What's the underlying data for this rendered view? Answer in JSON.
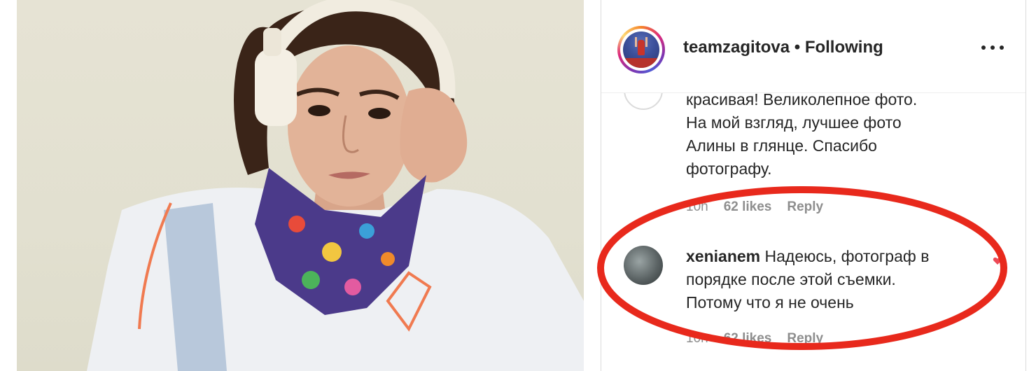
{
  "header": {
    "username": "teamzagitova",
    "separator": " • ",
    "follow_status": "Following",
    "more_icon": "more-options-icon"
  },
  "comments": [
    {
      "user": "",
      "text_lines": [
        "красивая! Великолепное фото.",
        "На мой взгляд, лучшее фото",
        "Алины в глянце. Спасибо",
        "фотографу."
      ],
      "time": "10n",
      "likes": "62 likes",
      "reply": "Reply"
    },
    {
      "user": "xenianem",
      "text_lines": [
        "Надеюсь, фотограф в",
        "порядке после этой съемки.",
        "Потому что я не очень"
      ],
      "time": "10n",
      "likes": "62 likes",
      "reply": "Reply"
    }
  ],
  "annotation_color": "#e8291c",
  "photo": "portrait photo of a woman wearing white headphones and a colorful scarf"
}
